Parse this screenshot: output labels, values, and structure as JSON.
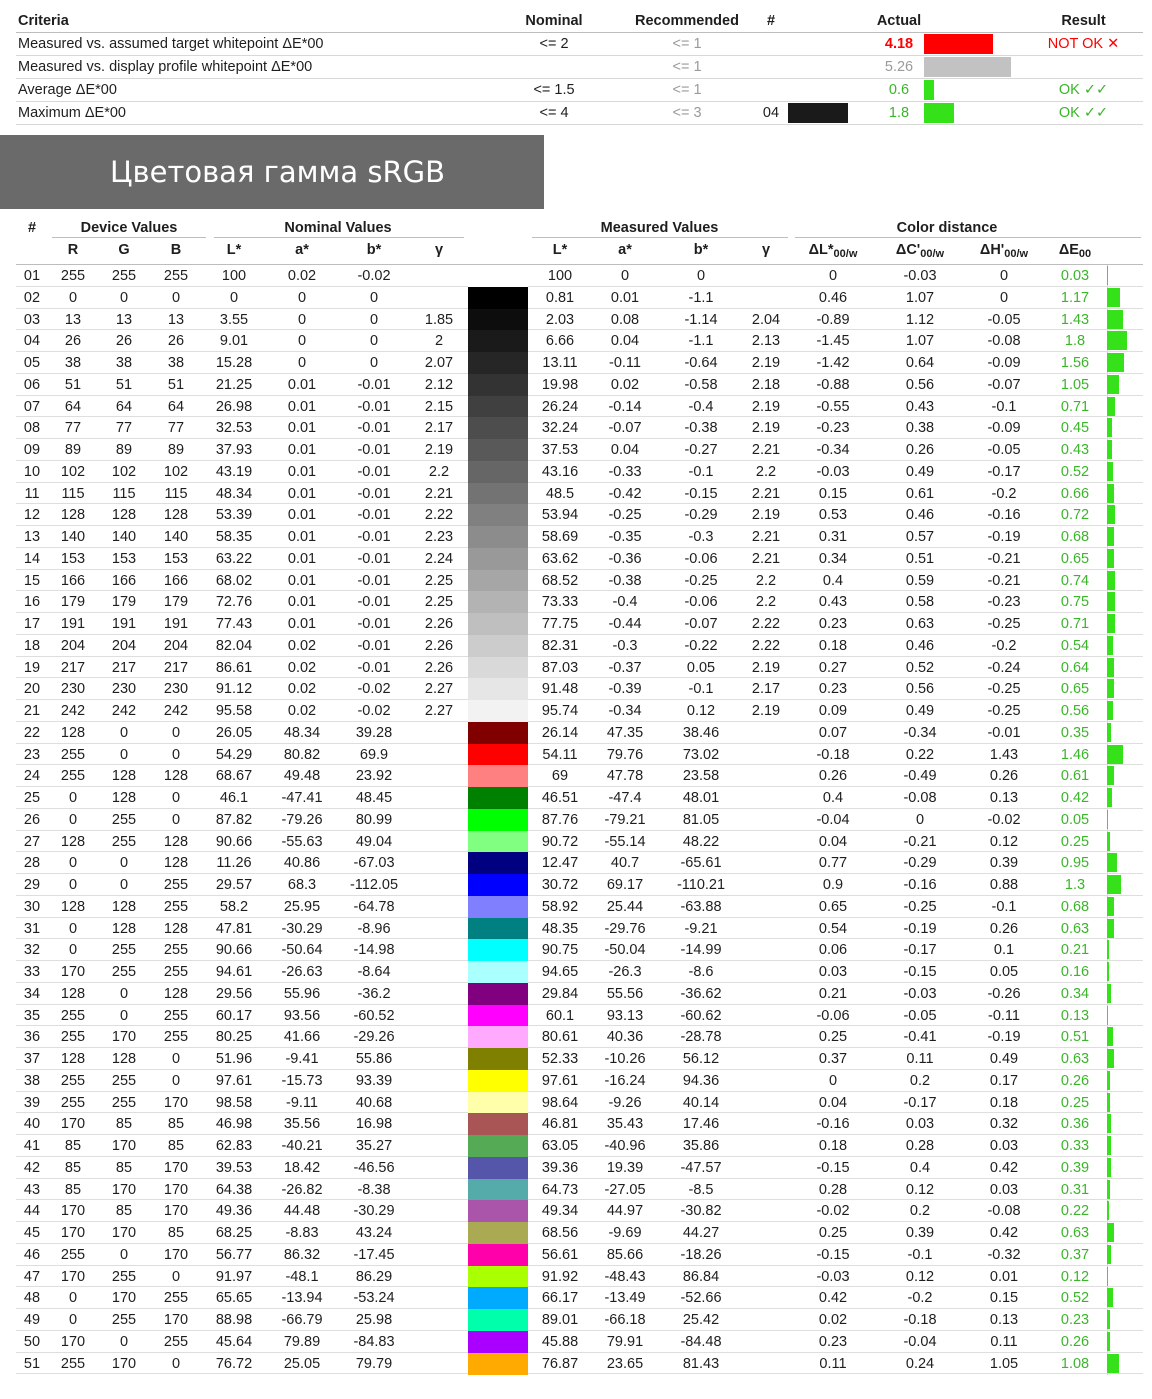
{
  "criteria": {
    "headers": {
      "criteria": "Criteria",
      "nominal": "Nominal",
      "recommended": "Recommended",
      "num": "#",
      "actual": "Actual",
      "result": "Result"
    },
    "rows": [
      {
        "name": "Measured vs. assumed target whitepoint ΔE*00",
        "nominal": "<= 2",
        "recommended": "<= 1",
        "num": "",
        "actual": "4.18",
        "actual_style": "bad",
        "bar_color": "#ff0000",
        "bar_value": 4.18,
        "result": "NOT OK ✕",
        "result_style": "bad"
      },
      {
        "name": "Measured vs. display profile whitepoint ΔE*00",
        "nominal": "",
        "recommended": "<= 1",
        "num": "",
        "actual": "5.26",
        "actual_style": "gray",
        "bar_color": "#c2c2c2",
        "bar_value": 5.26,
        "result": "",
        "result_style": ""
      },
      {
        "name": "Average ΔE*00",
        "nominal": "<= 1.5",
        "recommended": "<= 1",
        "num": "",
        "actual": "0.6",
        "actual_style": "good",
        "bar_color": "#35e21a",
        "bar_value": 0.6,
        "result": "OK ✓✓",
        "result_style": "good"
      },
      {
        "name": "Maximum ΔE*00",
        "nominal": "<= 4",
        "recommended": "<= 3",
        "num": "04",
        "actual": "1.8",
        "actual_style": "good",
        "bar_color": "#35e21a",
        "bar_value": 1.8,
        "result": "OK ✓✓",
        "result_style": "good"
      }
    ]
  },
  "banner": {
    "title": "Цветовая гамма sRGB"
  },
  "table": {
    "group_headers": {
      "num": "#",
      "device": "Device Values",
      "nominal": "Nominal Values",
      "measured": "Measured Values",
      "distance": "Color distance"
    },
    "column_headers": {
      "r": "R",
      "g": "G",
      "b": "B",
      "L": "L*",
      "a": "a*",
      "bb": "b*",
      "gamma": "γ",
      "mL": "L*",
      "ma": "a*",
      "mb": "b*",
      "mgamma": "γ",
      "dL": "ΔL*",
      "dC": "ΔC'",
      "dH": "ΔH'",
      "dE": "ΔE",
      "sub_w": "00/w",
      "sub_e": "00"
    },
    "rows": [
      [
        "01",
        "255",
        "255",
        "255",
        "100",
        "0.02",
        "-0.02",
        "",
        "100",
        "0",
        "0",
        "",
        "0",
        "-0.03",
        "0",
        "0.03",
        "#ffffff"
      ],
      [
        "02",
        "0",
        "0",
        "0",
        "0",
        "0",
        "0",
        "",
        "0.81",
        "0.01",
        "-1.1",
        "",
        "0.46",
        "1.07",
        "0",
        "1.17",
        "#000000"
      ],
      [
        "03",
        "13",
        "13",
        "13",
        "3.55",
        "0",
        "0",
        "1.85",
        "2.03",
        "0.08",
        "-1.14",
        "2.04",
        "-0.89",
        "1.12",
        "-0.05",
        "1.43",
        "#0d0d0d"
      ],
      [
        "04",
        "26",
        "26",
        "26",
        "9.01",
        "0",
        "0",
        "2",
        "6.66",
        "0.04",
        "-1.1",
        "2.13",
        "-1.45",
        "1.07",
        "-0.08",
        "1.8",
        "#1a1a1a"
      ],
      [
        "05",
        "38",
        "38",
        "38",
        "15.28",
        "0",
        "0",
        "2.07",
        "13.11",
        "-0.11",
        "-0.64",
        "2.19",
        "-1.42",
        "0.64",
        "-0.09",
        "1.56",
        "#262626"
      ],
      [
        "06",
        "51",
        "51",
        "51",
        "21.25",
        "0.01",
        "-0.01",
        "2.12",
        "19.98",
        "0.02",
        "-0.58",
        "2.18",
        "-0.88",
        "0.56",
        "-0.07",
        "1.05",
        "#333333"
      ],
      [
        "07",
        "64",
        "64",
        "64",
        "26.98",
        "0.01",
        "-0.01",
        "2.15",
        "26.24",
        "-0.14",
        "-0.4",
        "2.19",
        "-0.55",
        "0.43",
        "-0.1",
        "0.71",
        "#404040"
      ],
      [
        "08",
        "77",
        "77",
        "77",
        "32.53",
        "0.01",
        "-0.01",
        "2.17",
        "32.24",
        "-0.07",
        "-0.38",
        "2.19",
        "-0.23",
        "0.38",
        "-0.09",
        "0.45",
        "#4d4d4d"
      ],
      [
        "09",
        "89",
        "89",
        "89",
        "37.93",
        "0.01",
        "-0.01",
        "2.19",
        "37.53",
        "0.04",
        "-0.27",
        "2.21",
        "-0.34",
        "0.26",
        "-0.05",
        "0.43",
        "#595959"
      ],
      [
        "10",
        "102",
        "102",
        "102",
        "43.19",
        "0.01",
        "-0.01",
        "2.2",
        "43.16",
        "-0.33",
        "-0.1",
        "2.2",
        "-0.03",
        "0.49",
        "-0.17",
        "0.52",
        "#666666"
      ],
      [
        "11",
        "115",
        "115",
        "115",
        "48.34",
        "0.01",
        "-0.01",
        "2.21",
        "48.5",
        "-0.42",
        "-0.15",
        "2.21",
        "0.15",
        "0.61",
        "-0.2",
        "0.66",
        "#737373"
      ],
      [
        "12",
        "128",
        "128",
        "128",
        "53.39",
        "0.01",
        "-0.01",
        "2.22",
        "53.94",
        "-0.25",
        "-0.29",
        "2.19",
        "0.53",
        "0.46",
        "-0.16",
        "0.72",
        "#808080"
      ],
      [
        "13",
        "140",
        "140",
        "140",
        "58.35",
        "0.01",
        "-0.01",
        "2.23",
        "58.69",
        "-0.35",
        "-0.3",
        "2.21",
        "0.31",
        "0.57",
        "-0.19",
        "0.68",
        "#8c8c8c"
      ],
      [
        "14",
        "153",
        "153",
        "153",
        "63.22",
        "0.01",
        "-0.01",
        "2.24",
        "63.62",
        "-0.36",
        "-0.06",
        "2.21",
        "0.34",
        "0.51",
        "-0.21",
        "0.65",
        "#999999"
      ],
      [
        "15",
        "166",
        "166",
        "166",
        "68.02",
        "0.01",
        "-0.01",
        "2.25",
        "68.52",
        "-0.38",
        "-0.25",
        "2.2",
        "0.4",
        "0.59",
        "-0.21",
        "0.74",
        "#a6a6a6"
      ],
      [
        "16",
        "179",
        "179",
        "179",
        "72.76",
        "0.01",
        "-0.01",
        "2.25",
        "73.33",
        "-0.4",
        "-0.06",
        "2.2",
        "0.43",
        "0.58",
        "-0.23",
        "0.75",
        "#b3b3b3"
      ],
      [
        "17",
        "191",
        "191",
        "191",
        "77.43",
        "0.01",
        "-0.01",
        "2.26",
        "77.75",
        "-0.44",
        "-0.07",
        "2.22",
        "0.23",
        "0.63",
        "-0.25",
        "0.71",
        "#bfbfbf"
      ],
      [
        "18",
        "204",
        "204",
        "204",
        "82.04",
        "0.02",
        "-0.01",
        "2.26",
        "82.31",
        "-0.3",
        "-0.22",
        "2.22",
        "0.18",
        "0.46",
        "-0.2",
        "0.54",
        "#cccccc"
      ],
      [
        "19",
        "217",
        "217",
        "217",
        "86.61",
        "0.02",
        "-0.01",
        "2.26",
        "87.03",
        "-0.37",
        "0.05",
        "2.19",
        "0.27",
        "0.52",
        "-0.24",
        "0.64",
        "#d9d9d9"
      ],
      [
        "20",
        "230",
        "230",
        "230",
        "91.12",
        "0.02",
        "-0.02",
        "2.27",
        "91.48",
        "-0.39",
        "-0.1",
        "2.17",
        "0.23",
        "0.56",
        "-0.25",
        "0.65",
        "#e6e6e6"
      ],
      [
        "21",
        "242",
        "242",
        "242",
        "95.58",
        "0.02",
        "-0.02",
        "2.27",
        "95.74",
        "-0.34",
        "0.12",
        "2.19",
        "0.09",
        "0.49",
        "-0.25",
        "0.56",
        "#f2f2f2"
      ],
      [
        "22",
        "128",
        "0",
        "0",
        "26.05",
        "48.34",
        "39.28",
        "",
        "26.14",
        "47.35",
        "38.46",
        "",
        "0.07",
        "-0.34",
        "-0.01",
        "0.35",
        "#800000"
      ],
      [
        "23",
        "255",
        "0",
        "0",
        "54.29",
        "80.82",
        "69.9",
        "",
        "54.11",
        "79.76",
        "73.02",
        "",
        "-0.18",
        "0.22",
        "1.43",
        "1.46",
        "#ff0000"
      ],
      [
        "24",
        "255",
        "128",
        "128",
        "68.67",
        "49.48",
        "23.92",
        "",
        "69",
        "47.78",
        "23.58",
        "",
        "0.26",
        "-0.49",
        "0.26",
        "0.61",
        "#ff8080"
      ],
      [
        "25",
        "0",
        "128",
        "0",
        "46.1",
        "-47.41",
        "48.45",
        "",
        "46.51",
        "-47.4",
        "48.01",
        "",
        "0.4",
        "-0.08",
        "0.13",
        "0.42",
        "#008000"
      ],
      [
        "26",
        "0",
        "255",
        "0",
        "87.82",
        "-79.26",
        "80.99",
        "",
        "87.76",
        "-79.21",
        "81.05",
        "",
        "-0.04",
        "0",
        "-0.02",
        "0.05",
        "#00ff00"
      ],
      [
        "27",
        "128",
        "255",
        "128",
        "90.66",
        "-55.63",
        "49.04",
        "",
        "90.72",
        "-55.14",
        "48.22",
        "",
        "0.04",
        "-0.21",
        "0.12",
        "0.25",
        "#80ff80"
      ],
      [
        "28",
        "0",
        "0",
        "128",
        "11.26",
        "40.86",
        "-67.03",
        "",
        "12.47",
        "40.7",
        "-65.61",
        "",
        "0.77",
        "-0.29",
        "0.39",
        "0.95",
        "#000080"
      ],
      [
        "29",
        "0",
        "0",
        "255",
        "29.57",
        "68.3",
        "-112.05",
        "",
        "30.72",
        "69.17",
        "-110.21",
        "",
        "0.9",
        "-0.16",
        "0.88",
        "1.3",
        "#0000ff"
      ],
      [
        "30",
        "128",
        "128",
        "255",
        "58.2",
        "25.95",
        "-64.78",
        "",
        "58.92",
        "25.44",
        "-63.88",
        "",
        "0.65",
        "-0.25",
        "-0.1",
        "0.68",
        "#8080ff"
      ],
      [
        "31",
        "0",
        "128",
        "128",
        "47.81",
        "-30.29",
        "-8.96",
        "",
        "48.35",
        "-29.76",
        "-9.21",
        "",
        "0.54",
        "-0.19",
        "0.26",
        "0.63",
        "#008080"
      ],
      [
        "32",
        "0",
        "255",
        "255",
        "90.66",
        "-50.64",
        "-14.98",
        "",
        "90.75",
        "-50.04",
        "-14.99",
        "",
        "0.06",
        "-0.17",
        "0.1",
        "0.21",
        "#00ffff"
      ],
      [
        "33",
        "170",
        "255",
        "255",
        "94.61",
        "-26.63",
        "-8.64",
        "",
        "94.65",
        "-26.3",
        "-8.6",
        "",
        "0.03",
        "-0.15",
        "0.05",
        "0.16",
        "#aaffff"
      ],
      [
        "34",
        "128",
        "0",
        "128",
        "29.56",
        "55.96",
        "-36.2",
        "",
        "29.84",
        "55.56",
        "-36.62",
        "",
        "0.21",
        "-0.03",
        "-0.26",
        "0.34",
        "#800080"
      ],
      [
        "35",
        "255",
        "0",
        "255",
        "60.17",
        "93.56",
        "-60.52",
        "",
        "60.1",
        "93.13",
        "-60.62",
        "",
        "-0.06",
        "-0.05",
        "-0.11",
        "0.13",
        "#ff00ff"
      ],
      [
        "36",
        "255",
        "170",
        "255",
        "80.25",
        "41.66",
        "-29.26",
        "",
        "80.61",
        "40.36",
        "-28.78",
        "",
        "0.25",
        "-0.41",
        "-0.19",
        "0.51",
        "#ffaaff"
      ],
      [
        "37",
        "128",
        "128",
        "0",
        "51.96",
        "-9.41",
        "55.86",
        "",
        "52.33",
        "-10.26",
        "56.12",
        "",
        "0.37",
        "0.11",
        "0.49",
        "0.63",
        "#808000"
      ],
      [
        "38",
        "255",
        "255",
        "0",
        "97.61",
        "-15.73",
        "93.39",
        "",
        "97.61",
        "-16.24",
        "94.36",
        "",
        "0",
        "0.2",
        "0.17",
        "0.26",
        "#ffff00"
      ],
      [
        "39",
        "255",
        "255",
        "170",
        "98.58",
        "-9.11",
        "40.68",
        "",
        "98.64",
        "-9.26",
        "40.14",
        "",
        "0.04",
        "-0.17",
        "0.18",
        "0.25",
        "#ffffaa"
      ],
      [
        "40",
        "170",
        "85",
        "85",
        "46.98",
        "35.56",
        "16.98",
        "",
        "46.81",
        "35.43",
        "17.46",
        "",
        "-0.16",
        "0.03",
        "0.32",
        "0.36",
        "#aa5555"
      ],
      [
        "41",
        "85",
        "170",
        "85",
        "62.83",
        "-40.21",
        "35.27",
        "",
        "63.05",
        "-40.96",
        "35.86",
        "",
        "0.18",
        "0.28",
        "0.03",
        "0.33",
        "#55aa55"
      ],
      [
        "42",
        "85",
        "85",
        "170",
        "39.53",
        "18.42",
        "-46.56",
        "",
        "39.36",
        "19.39",
        "-47.57",
        "",
        "-0.15",
        "0.4",
        "0.42",
        "0.39",
        "#5555aa"
      ],
      [
        "43",
        "85",
        "170",
        "170",
        "64.38",
        "-26.82",
        "-8.38",
        "",
        "64.73",
        "-27.05",
        "-8.5",
        "",
        "0.28",
        "0.12",
        "0.03",
        "0.31",
        "#55aaaa"
      ],
      [
        "44",
        "170",
        "85",
        "170",
        "49.36",
        "44.48",
        "-30.29",
        "",
        "49.34",
        "44.97",
        "-30.82",
        "",
        "-0.02",
        "0.2",
        "-0.08",
        "0.22",
        "#aa55aa"
      ],
      [
        "45",
        "170",
        "170",
        "85",
        "68.25",
        "-8.83",
        "43.24",
        "",
        "68.56",
        "-9.69",
        "44.27",
        "",
        "0.25",
        "0.39",
        "0.42",
        "0.63",
        "#aaaa55"
      ],
      [
        "46",
        "255",
        "0",
        "170",
        "56.77",
        "86.32",
        "-17.45",
        "",
        "56.61",
        "85.66",
        "-18.26",
        "",
        "-0.15",
        "-0.1",
        "-0.32",
        "0.37",
        "#ff00aa"
      ],
      [
        "47",
        "170",
        "255",
        "0",
        "91.97",
        "-48.1",
        "86.29",
        "",
        "91.92",
        "-48.43",
        "86.84",
        "",
        "-0.03",
        "0.12",
        "0.01",
        "0.12",
        "#aaff00"
      ],
      [
        "48",
        "0",
        "170",
        "255",
        "65.65",
        "-13.94",
        "-53.24",
        "",
        "66.17",
        "-13.49",
        "-52.66",
        "",
        "0.42",
        "-0.2",
        "0.15",
        "0.52",
        "#00aaff"
      ],
      [
        "49",
        "0",
        "255",
        "170",
        "88.98",
        "-66.79",
        "25.98",
        "",
        "89.01",
        "-66.18",
        "25.42",
        "",
        "0.02",
        "-0.18",
        "0.13",
        "0.23",
        "#00ffaa"
      ],
      [
        "50",
        "170",
        "0",
        "255",
        "45.64",
        "79.89",
        "-84.83",
        "",
        "45.88",
        "79.91",
        "-84.48",
        "",
        "0.23",
        "-0.04",
        "0.11",
        "0.26",
        "#aa00ff"
      ],
      [
        "51",
        "255",
        "170",
        "0",
        "76.72",
        "25.05",
        "79.79",
        "",
        "76.87",
        "23.65",
        "81.43",
        "",
        "0.11",
        "0.24",
        "1.05",
        "1.08",
        "#ffaa00"
      ]
    ]
  }
}
